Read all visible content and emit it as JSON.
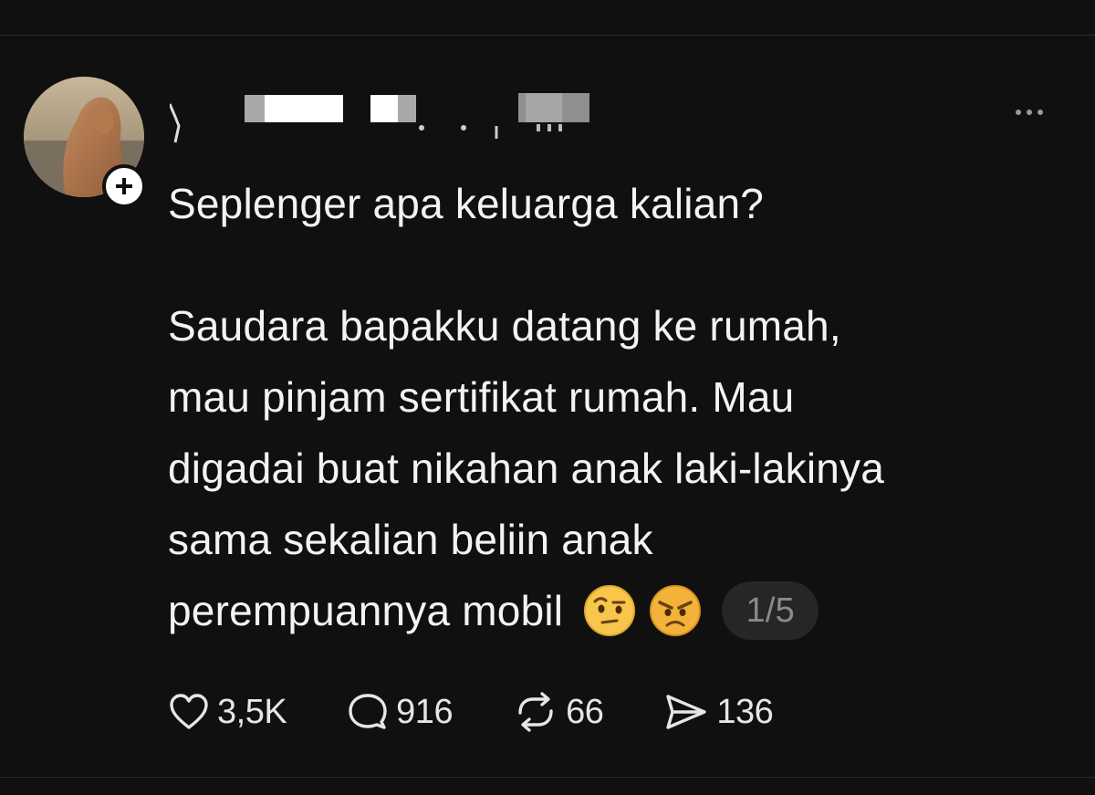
{
  "post": {
    "title": "Seplenger apa keluarga kalian?",
    "body_lines": [
      "Saudara bapakku datang ke rumah,",
      "mau pinjam sertifikat rumah. Mau",
      "digadai buat nikahan anak laki-lakinya",
      "sama sekalian beliin anak",
      "perempuannya mobil"
    ],
    "emojis": [
      "raised-eyebrow-emoji",
      "angry-face-emoji"
    ],
    "page_counter": "1/5"
  },
  "actions": {
    "likes": "3,5K",
    "replies": "916",
    "reposts": "66",
    "shares": "136"
  },
  "icons": {
    "like": "heart-icon",
    "reply": "speech-bubble-icon",
    "repost": "repost-arrows-icon",
    "share": "send-icon",
    "follow": "plus-icon",
    "more": "ellipsis-icon"
  },
  "colors": {
    "background": "#101010",
    "text": "#f3f3f3",
    "muted": "#8a8a8a",
    "pill": "#262626"
  }
}
